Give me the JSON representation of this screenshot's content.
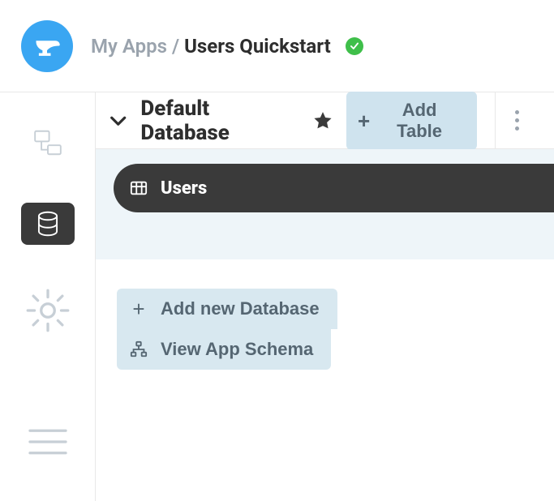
{
  "header": {
    "breadcrumb_root": "My Apps",
    "breadcrumb_separator": "/",
    "breadcrumb_active": "Users Quickstart"
  },
  "sidebar": {
    "items": [
      {
        "id": "design",
        "icon": "tree-icon"
      },
      {
        "id": "database",
        "icon": "database-icon"
      },
      {
        "id": "settings",
        "icon": "gear-icon"
      },
      {
        "id": "menu",
        "icon": "menu-icon"
      }
    ],
    "active_id": "database"
  },
  "panel": {
    "title": "Default Database",
    "add_table_label": "Add Table"
  },
  "tables": [
    {
      "name": "Users",
      "icon": "grid-icon"
    }
  ],
  "actions": {
    "add_db_label": "Add new Database",
    "view_schema_label": "View App Schema"
  },
  "colors": {
    "accent": "#3aa6f2",
    "success": "#3fbf4a",
    "chip": "#cfe3ee",
    "chip2": "#d8e8f0",
    "pill": "#3a3a3a",
    "muted": "#9aa3ad"
  }
}
